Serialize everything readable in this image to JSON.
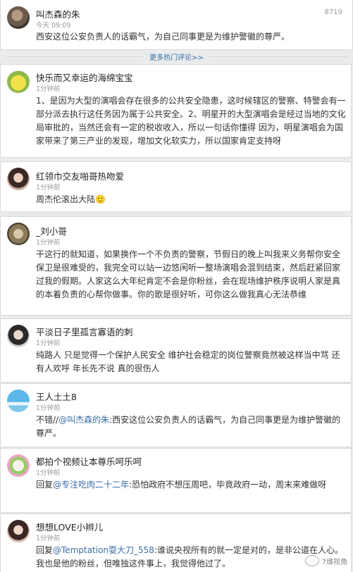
{
  "top_comment": {
    "user": "叫杰森的朱",
    "time": "今天 09:09",
    "likes": "8719",
    "text": "西安这位公安负责人的话霸气，为自己同事更是为维护警徽的尊严。"
  },
  "more_link": "更多热门评论>>",
  "comments": [
    {
      "user": "快乐而又幸运的海绵宝宝",
      "time": "1分钟前",
      "text": "1、是因为大型的演唱会存在很多的公共安全隐患，这时候辖区的警察、特警会有一部分派去执行这任务因为属于公共安全。2、明星开的大型演唱会是经过当地的文化局审批的，当然还会有一定的税收收入，所以一句话你懂得 因为，明星演唱会为国家带来了第三产业的发现，增加文化软实力，所以国家肯定支持呀"
    },
    {
      "user": "红领巾交友啪哥热吻爱",
      "time": "1分钟前",
      "text": "周杰伦滚出大陆🙂"
    },
    {
      "user": "_刘小哥",
      "time": "1分钟前",
      "text": "干这行的就知道，如果换作一个不负责的警察，节假日的晚上叫我来义务帮你安全保卫是很难受的，我完全可以站一边悠闲听一整场演唱会混到结束，然后赶紧回家过我的假期。人家这么大年纪肯定不会是你粉丝，会在现场维护秩序说明人家是真的本着负责的心帮你做事。你的歌是很好听，可你这么做我真心无法恭维"
    },
    {
      "user": "平淡日子里孤言寡语的刺",
      "time": "1分钟前",
      "text": "纯路人 只是觉得一个保护人民安全 维护社会稳定的岗位警察竟然被这样当中骂 还有人欢呼 年长先不说 真的很伤人"
    },
    {
      "user": "王人土土8",
      "time": "1分钟前",
      "prefix": "不错//",
      "mention": "@叫杰森的朱",
      "suffix": ":西安这位公安负责人的话霸气，为自己同事更是为维护警徽的尊严。"
    },
    {
      "user": "都拍个视频让本尊乐呵乐呵",
      "time": "1分钟前",
      "prefix": "回复",
      "mention": "@专注吃肉二十二年",
      "suffix": ":恐怕政府不想压周吧，毕竟政府一动，周末来难做呀"
    },
    {
      "user": "想想LOVE小辫儿",
      "time": "1分钟前",
      "prefix": "回复",
      "mention": "@Temptation耍大刀_558",
      "suffix": ":谁说央视所有的就一定是对的，是非公道在人心。我也是他的粉丝，但唯独这件事上，我觉得他过了。"
    }
  ],
  "watermark": "7维视角",
  "colors": {
    "link": "#3b6ea5",
    "background": "#e9ebed",
    "card": "#ffffff"
  }
}
